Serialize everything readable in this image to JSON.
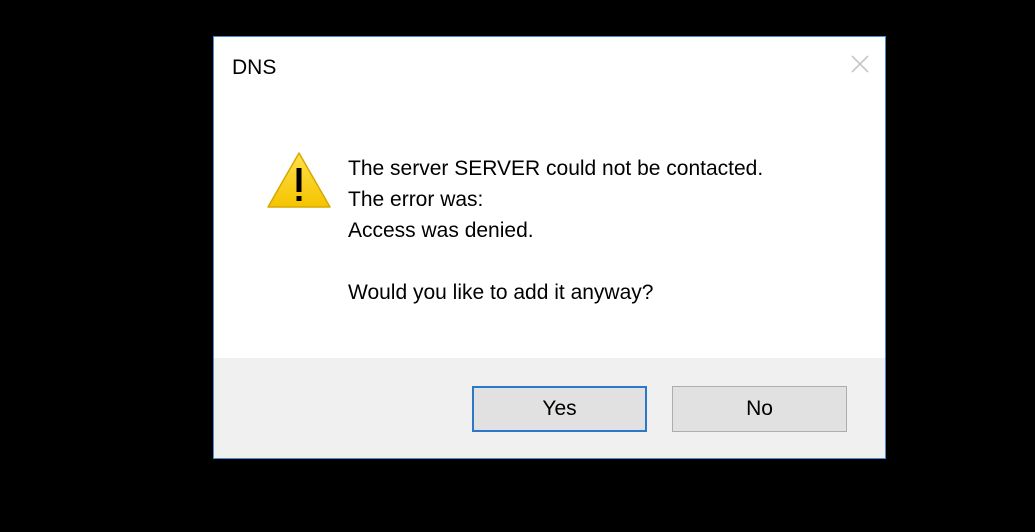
{
  "dialog": {
    "title": "DNS",
    "message_lines": [
      "The server SERVER could not be contacted.",
      "The error was:",
      "Access was denied."
    ],
    "question": "Would you like to add it anyway?",
    "buttons": {
      "yes_label": "Yes",
      "no_label": "No"
    },
    "icon": "warning-icon"
  },
  "colors": {
    "background": "#000000",
    "dialog_border": "#4a8bd1",
    "footer": "#f0f0f0",
    "button": "#e1e1e1",
    "default_button_border": "#2b78c9",
    "warning_yellow": "#ffd700"
  }
}
